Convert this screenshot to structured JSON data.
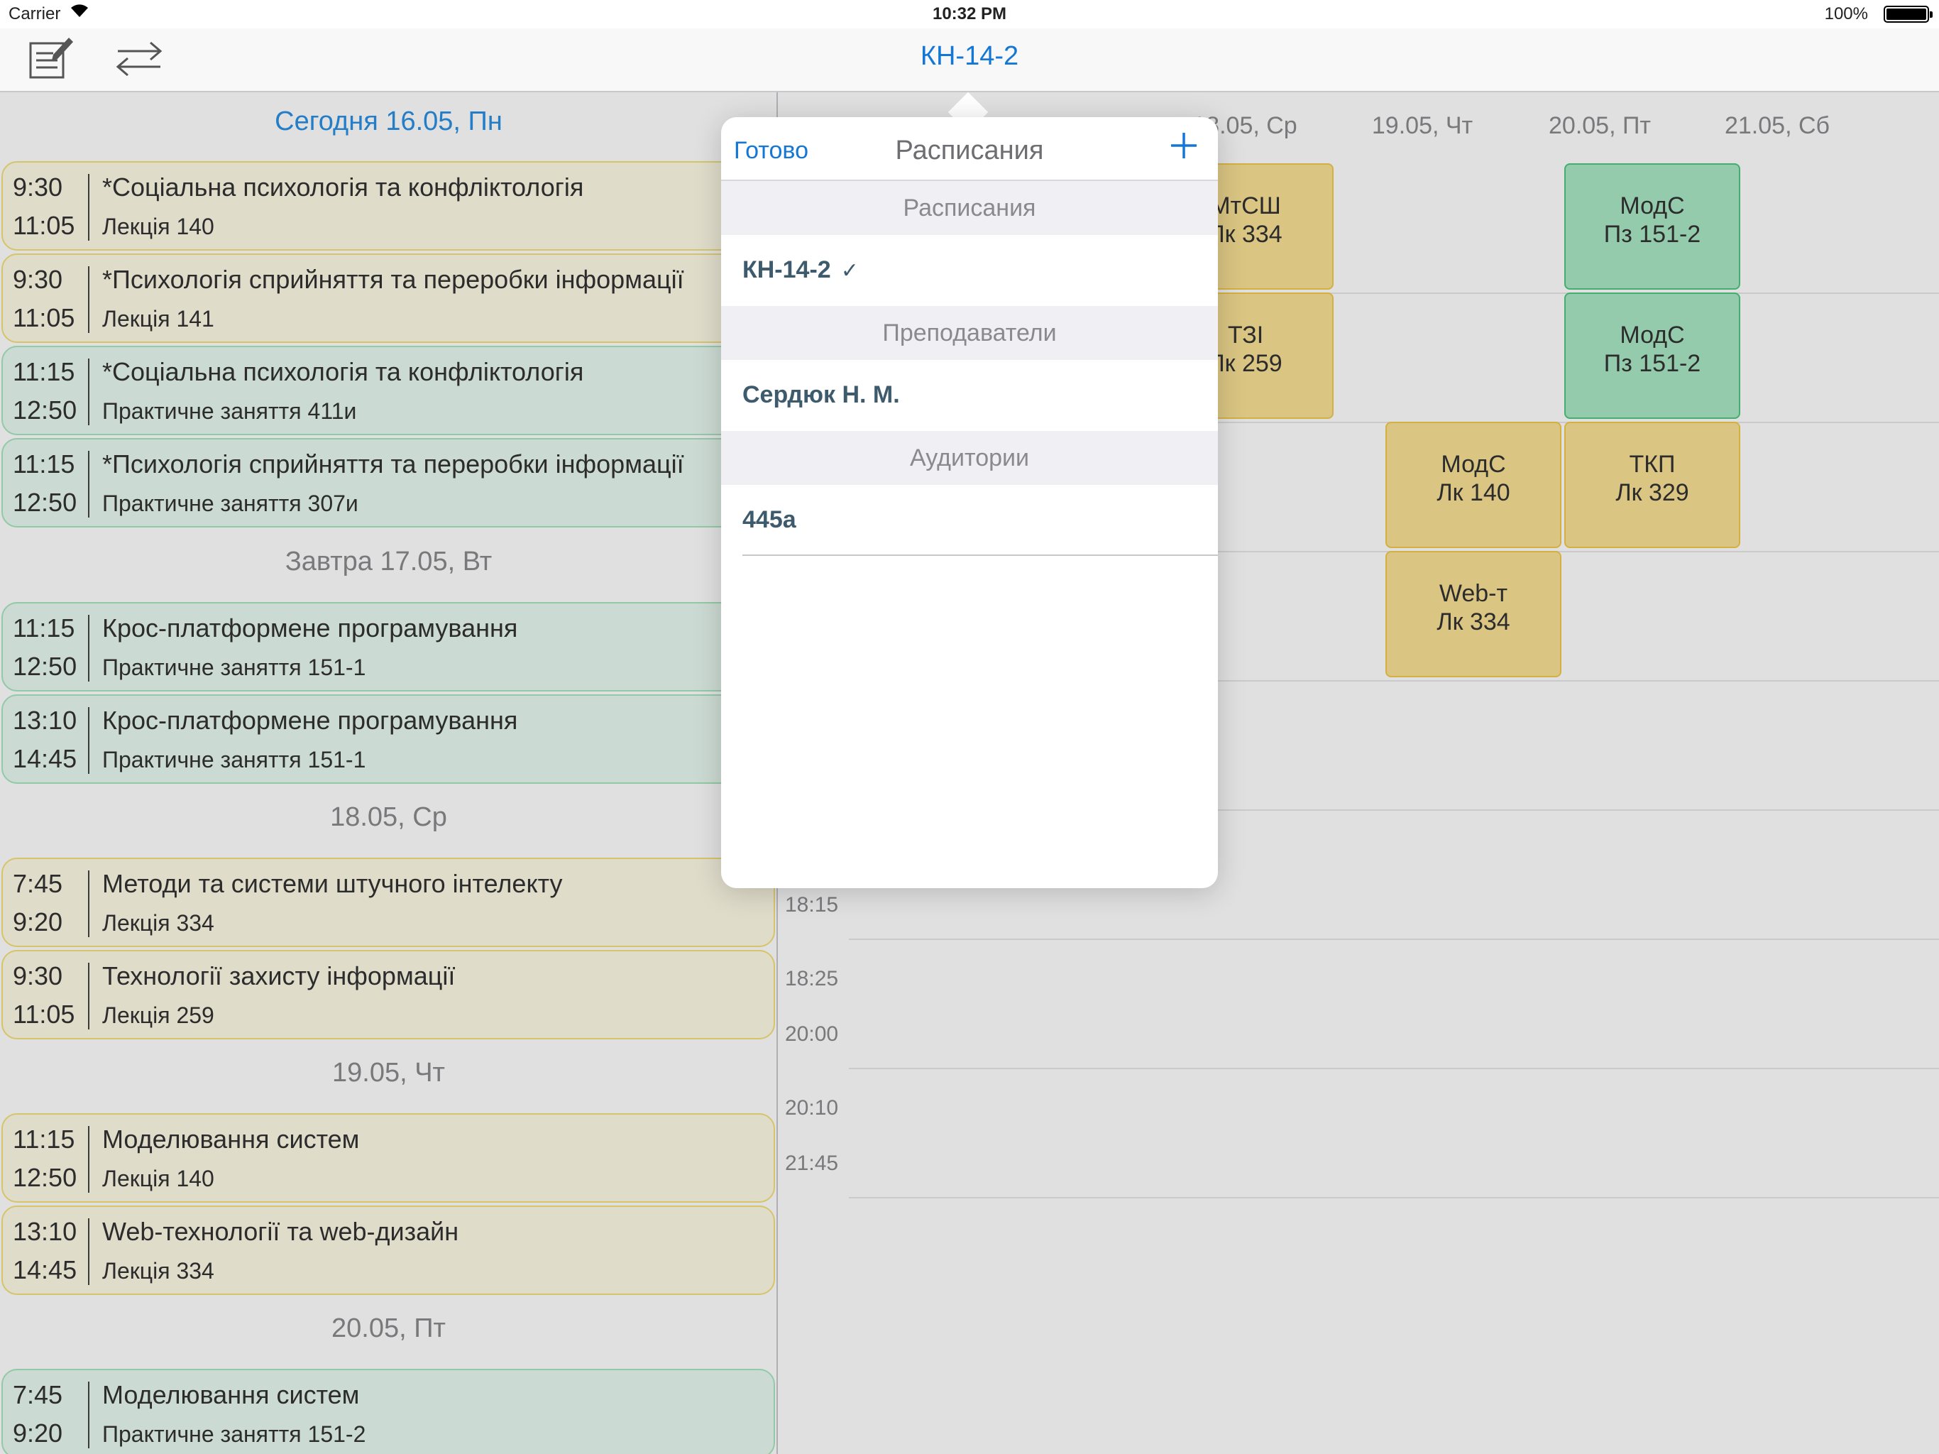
{
  "status_bar": {
    "carrier": "Carrier",
    "time": "10:32 PM",
    "battery": "100%"
  },
  "nav": {
    "title": "КН-14-2"
  },
  "list": {
    "sections": [
      {
        "header": "Сегодня 16.05, Пн",
        "lessons": [
          {
            "start": "9:30",
            "end": "11:05",
            "subject": "*Соціальна психологія та конфліктологія",
            "type": "Лекція 140",
            "kind": "lecture"
          },
          {
            "start": "9:30",
            "end": "11:05",
            "subject": "*Психологія сприйняття та переробки інформації",
            "type": "Лекція 141",
            "kind": "lecture"
          },
          {
            "start": "11:15",
            "end": "12:50",
            "subject": "*Соціальна психологія та конфліктологія",
            "type": "Практичне заняття 411и",
            "kind": "practice"
          },
          {
            "start": "11:15",
            "end": "12:50",
            "subject": "*Психологія сприйняття та переробки інформації",
            "type": "Практичне заняття 307и",
            "kind": "practice"
          }
        ]
      },
      {
        "header": "Завтра 17.05, Вт",
        "lessons": [
          {
            "start": "11:15",
            "end": "12:50",
            "subject": "Крос-платформене програмування",
            "type": "Практичне заняття 151-1",
            "kind": "practice"
          },
          {
            "start": "13:10",
            "end": "14:45",
            "subject": "Крос-платформене програмування",
            "type": "Практичне заняття 151-1",
            "kind": "practice"
          }
        ]
      },
      {
        "header": "18.05, Ср",
        "lessons": [
          {
            "start": "7:45",
            "end": "9:20",
            "subject": "Методи та системи штучного інтелекту",
            "type": "Лекція 334",
            "kind": "lecture"
          },
          {
            "start": "9:30",
            "end": "11:05",
            "subject": "Технології захисту інформації",
            "type": "Лекція 259",
            "kind": "lecture"
          }
        ]
      },
      {
        "header": "19.05, Чт",
        "lessons": [
          {
            "start": "11:15",
            "end": "12:50",
            "subject": "Моделювання систем",
            "type": "Лекція 140",
            "kind": "lecture"
          },
          {
            "start": "13:10",
            "end": "14:45",
            "subject": "Web-технології та web-дизайн",
            "type": "Лекція 334",
            "kind": "lecture"
          }
        ]
      },
      {
        "header": "20.05, Пт",
        "lessons": [
          {
            "start": "7:45",
            "end": "9:20",
            "subject": "Моделювання систем",
            "type": "Практичне заняття 151-2",
            "kind": "practice"
          }
        ]
      }
    ]
  },
  "grid": {
    "columns": [
      "18.05, Ср",
      "19.05, Чт",
      "20.05, Пт",
      "21.05, Сб"
    ],
    "times": [
      "18:15",
      "18:25",
      "20:00",
      "20:10",
      "21:45"
    ],
    "cells": [
      {
        "name": "МтСШ",
        "room": "Лк 334",
        "kind": "lecture"
      },
      {
        "name": "ТЗІ",
        "room": "Лк 259",
        "kind": "lecture"
      },
      {
        "name": "МодС",
        "room": "Пз 151-2",
        "kind": "practice"
      },
      {
        "name": "МодС",
        "room": "Пз 151-2",
        "kind": "practice"
      },
      {
        "name": "МодС",
        "room": "Лк 140",
        "kind": "lecture"
      },
      {
        "name": "ТКП",
        "room": "Лк 329",
        "kind": "lecture"
      },
      {
        "name": "Web-т",
        "room": "Лк 334",
        "kind": "lecture"
      }
    ]
  },
  "popover": {
    "done": "Готово",
    "title": "Расписания",
    "sections": [
      {
        "header": "Расписания",
        "item": "КН-14-2",
        "check": "✓"
      },
      {
        "header": "Преподаватели",
        "item": "Сердюк Н. М."
      },
      {
        "header": "Аудитории",
        "item": "445а"
      }
    ]
  },
  "colors": {
    "accent": "#1477d6",
    "lecture_bg": "#fffbe6",
    "practice_bg": "#e8f9ef",
    "lecture_cell": "#f9e195",
    "practice_cell": "#a9e7c4"
  },
  "icons": {
    "edit": "edit-icon",
    "swap": "swap-arrows-icon",
    "add": "plus-icon",
    "wifi": "wifi-icon",
    "battery": "battery-icon"
  }
}
